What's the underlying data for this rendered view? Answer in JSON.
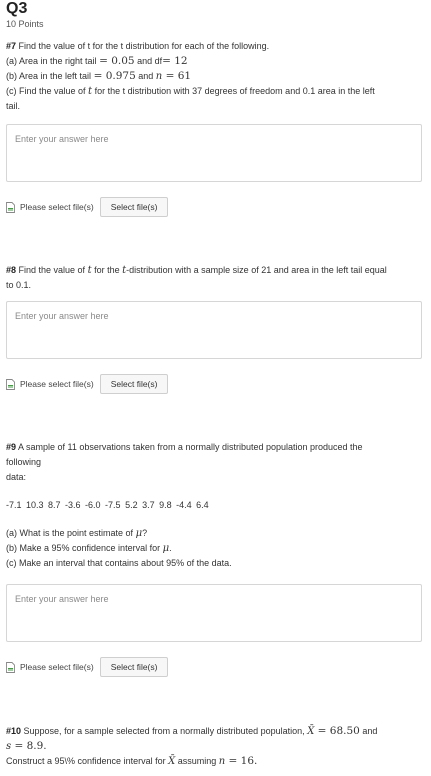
{
  "header": {
    "title": "Q3",
    "points": "10 Points"
  },
  "q7": {
    "number": "#7",
    "prompt": "Find the value of t for the t distribution for each of the following.",
    "a_prefix": "(a) Area in the right tail",
    "a_eq1": "= 0.05",
    "a_mid": " and df",
    "a_eq2": "= 12",
    "b_prefix": "(b) Area in the left tail",
    "b_eq1": "= 0.975",
    "b_mid": " and ",
    "b_var": "n",
    "b_eq2": " = 61",
    "c_prefix": "(c) Find the value of ",
    "c_var": "t",
    "c_rest": " for the t distribution with 37 degrees of freedom and 0.1 area in the left",
    "c_tail": "tail."
  },
  "q8": {
    "number": "#8",
    "p1": " Find the value of ",
    "v1": "t",
    "p2": " for the ",
    "v2": "t",
    "p3": "-distribution with a sample size of 21 and area in the left tail equal",
    "p4": "to 0.1."
  },
  "q9": {
    "number": "#9",
    "p1": " A sample of 11 observations taken from a normally distributed population produced the",
    "p2": "following",
    "p3": "data:",
    "data": "-7.1  10.3  8.7  -3.6  -6.0  -7.5  5.2  3.7  9.8  -4.4  6.4",
    "a": "(a) What is the point estimate of ",
    "a_var": "μ",
    "a_end": "?",
    "b": "(b) Make a 95% confidence interval for ",
    "b_var": "μ",
    "b_end": ".",
    "c": "(c) Make an interval that contains about 95% of the data."
  },
  "q10": {
    "number": "#10",
    "p1": " Suppose, for a sample selected from a normally distributed population, ",
    "xbar": "X̄",
    "eq1": " = 68.50",
    "and": " and",
    "s_var": "s",
    "s_eq": " = 8.9.",
    "p2": "Construct a 95\\% confidence interval for ",
    "xbar2": "X̄",
    "p3": "  assuming ",
    "n_var": "n",
    "n_eq": " = 16."
  },
  "answer": {
    "placeholder": "Enter your answer here"
  },
  "upload": {
    "label": "Please select file(s)",
    "button": "Select file(s)"
  }
}
